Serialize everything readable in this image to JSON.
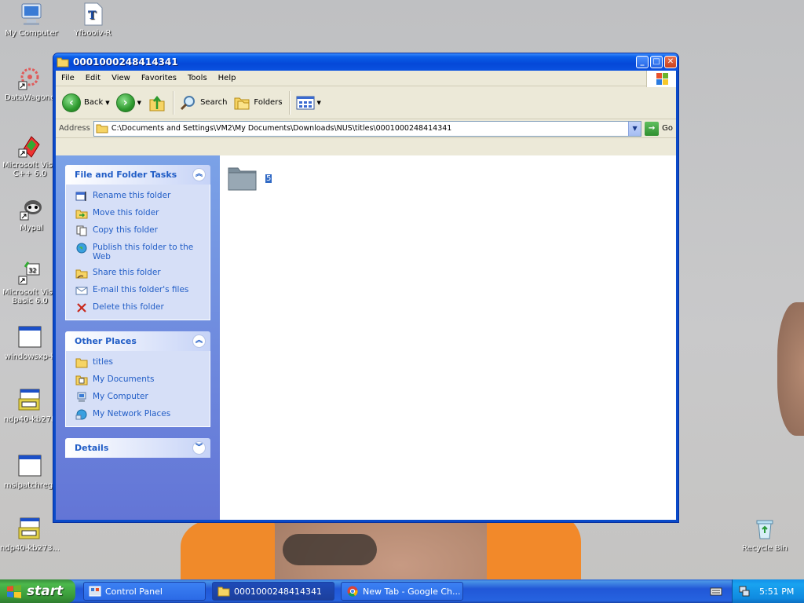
{
  "desktop": {
    "icons": [
      {
        "label": "My Computer"
      },
      {
        "label": "Yfbooiv-R"
      },
      {
        "label": "DataWagone"
      },
      {
        "label": "Microsoft Visu C++ 6.0"
      },
      {
        "label": "Mypal"
      },
      {
        "label": "Microsoft Visu Basic 6.0"
      },
      {
        "label": "windowsxp-k"
      },
      {
        "label": "ndp40-kb278"
      },
      {
        "label": "msipatchregt"
      },
      {
        "label": "ndp40-kb273..."
      },
      {
        "label": "Recycle Bin"
      }
    ]
  },
  "window": {
    "title": "0001000248414341",
    "buttons": {
      "minimize": "_",
      "maximize": "□",
      "close": "✕"
    },
    "menu": [
      "File",
      "Edit",
      "View",
      "Favorites",
      "Tools",
      "Help"
    ],
    "toolbar": {
      "back": "Back",
      "search": "Search",
      "folders": "Folders"
    },
    "address": {
      "label": "Address",
      "value": "C:\\Documents and Settings\\VM2\\My Documents\\Downloads\\NUS\\titles\\0001000248414341",
      "go": "Go"
    },
    "tasks_panel": {
      "title": "File and Folder Tasks",
      "items": [
        {
          "label": "Rename this folder"
        },
        {
          "label": "Move this folder"
        },
        {
          "label": "Copy this folder"
        },
        {
          "label": "Publish this folder to the Web"
        },
        {
          "label": "Share this folder"
        },
        {
          "label": "E-mail this folder's files"
        },
        {
          "label": "Delete this folder"
        }
      ]
    },
    "places_panel": {
      "title": "Other Places",
      "items": [
        {
          "label": "titles"
        },
        {
          "label": "My Documents"
        },
        {
          "label": "My Computer"
        },
        {
          "label": "My Network Places"
        }
      ]
    },
    "details_panel": {
      "title": "Details"
    },
    "files": [
      {
        "name": "5"
      }
    ]
  },
  "taskbar": {
    "start": "start",
    "tasks": [
      {
        "label": "Control Panel"
      },
      {
        "label": "0001000248414341"
      },
      {
        "label": "New Tab - Google Ch..."
      }
    ],
    "clock": "5:51 PM"
  }
}
